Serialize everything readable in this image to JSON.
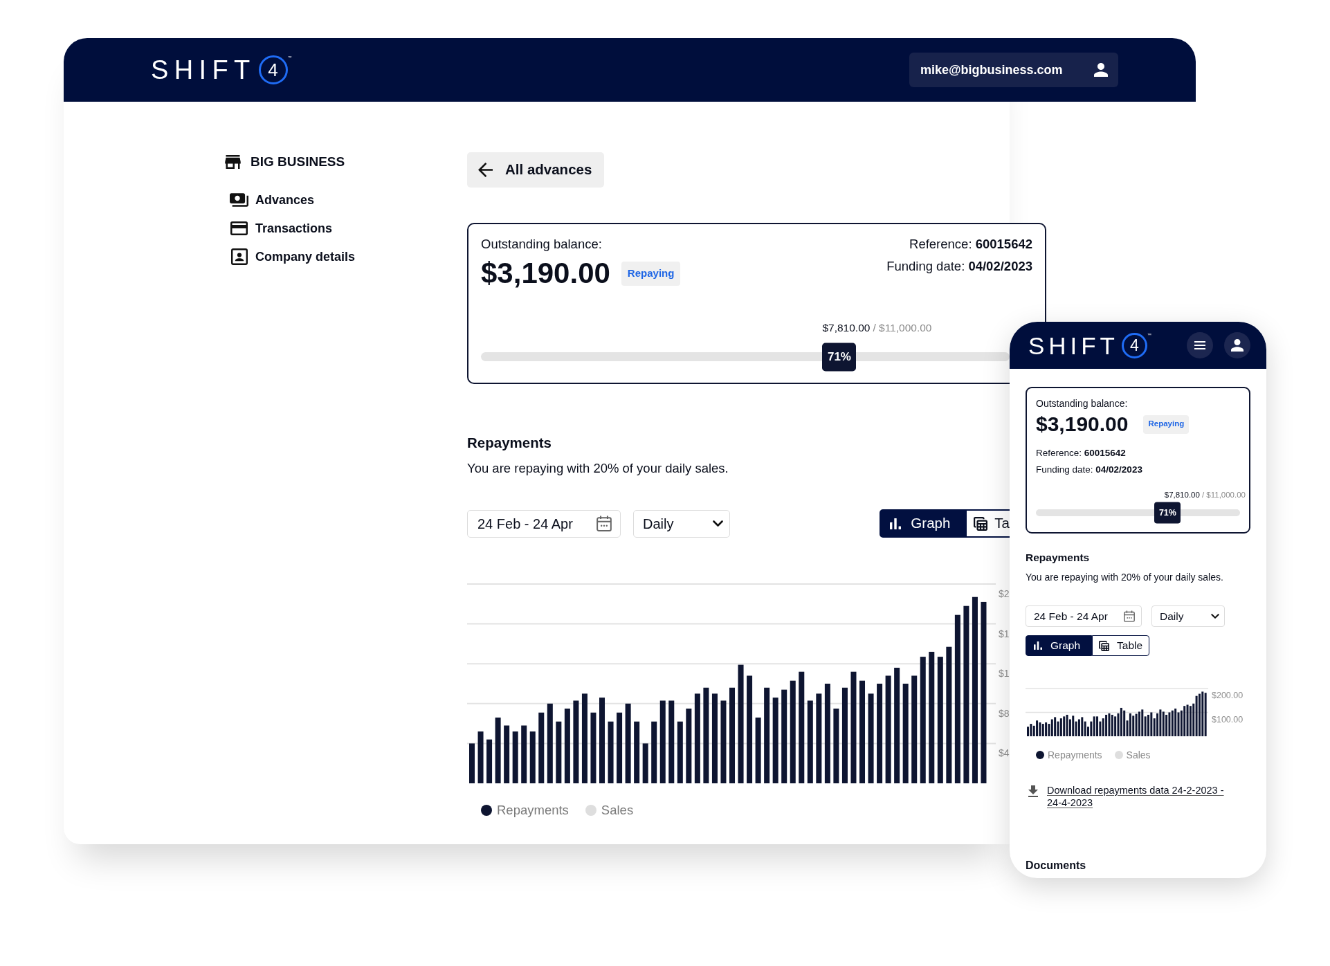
{
  "desktop": {
    "header": {
      "logo": {
        "word": "SHIFT",
        "digit": "4",
        "mark": "™"
      },
      "account_email": "mike@bigbusiness.com"
    },
    "sidebar": {
      "business_name": "BIG BUSINESS",
      "items": [
        {
          "label": "Advances"
        },
        {
          "label": "Transactions"
        },
        {
          "label": "Company details"
        }
      ]
    },
    "back_button": "All advances",
    "balance_card": {
      "label": "Outstanding balance:",
      "amount": "$3,190.00",
      "status": "Repaying",
      "reference": "Reference: **60015642**",
      "funding": "Funding date: **04/02/2023**",
      "paid": "$7,810.00",
      "total": "/ $11,000.00",
      "percent": "71%",
      "level": 0.71
    },
    "repayments": {
      "title": "Repayments",
      "description": "You are repaying with 20% of your daily sales.",
      "date_range": "24 Feb - 24 Apr",
      "interval": "Daily",
      "view_tabs": [
        {
          "label": "Graph",
          "selected": true
        },
        {
          "label": "Ta",
          "selected": false
        }
      ],
      "axis_labels": [
        "$2",
        "$1",
        "$1",
        "$8",
        "$4"
      ],
      "legend": [
        {
          "label": "Repayments",
          "color": "#0e1531"
        },
        {
          "label": "Sales",
          "color": "#dedede"
        }
      ]
    }
  },
  "mobile": {
    "header": {
      "logo": {
        "word": "SHIFT",
        "digit": "4",
        "mark": "™"
      }
    },
    "balance_card": {
      "label": "Outstanding balance:",
      "amount": "$3,190.00",
      "status": "Repaying",
      "reference": "Reference: **60015642**",
      "funding": "Funding date: **04/02/2023**",
      "paid": "$7,810.00",
      "total": "/ $11,000.00",
      "percent": "71%",
      "level": 0.71
    },
    "repayments": {
      "title": "Repayments",
      "description": "You are repaying with 20% of your daily sales.",
      "date_range": "24 Feb - 24 Apr",
      "interval": "Daily",
      "view_tabs": [
        {
          "label": "Graph",
          "selected": true
        },
        {
          "label": "Table",
          "selected": false
        }
      ],
      "chart_data": {
        "type": "bar",
        "categories": [
          null,
          null,
          null,
          null,
          null,
          null,
          null,
          null,
          null,
          null,
          null,
          null,
          null,
          null,
          null,
          null,
          null,
          null,
          null,
          null,
          null,
          null,
          null,
          null,
          null,
          null,
          null,
          null,
          null,
          null,
          null,
          null,
          null,
          null,
          null,
          null,
          null,
          null,
          null,
          null,
          null,
          null,
          null,
          null,
          null,
          null,
          null,
          null,
          null,
          null,
          null,
          null,
          null,
          null,
          null,
          null,
          null,
          null,
          null,
          null
        ],
        "values": [
          40,
          52,
          44,
          66,
          58,
          52,
          58,
          52,
          71,
          80,
          62,
          75,
          83,
          90,
          71,
          86,
          62,
          71,
          80,
          62,
          40,
          62,
          83,
          83,
          62,
          75,
          90,
          96,
          90,
          83,
          96,
          119,
          108,
          66,
          96,
          86,
          94,
          103,
          112,
          83,
          90,
          100,
          75,
          96,
          112,
          103,
          90,
          100,
          108,
          116,
          100,
          108,
          127,
          132,
          127,
          137,
          169,
          178,
          187,
          182
        ],
        "ylim": [
          0,
          200
        ],
        "yticks": [
          {
            "value": 100,
            "label": "$100.00"
          },
          {
            "value": 200,
            "label": "$200.00"
          }
        ]
      },
      "legend": [
        {
          "label": "Repayments",
          "color": "#0e1531"
        },
        {
          "label": "Sales",
          "color": "#dedede"
        }
      ],
      "download_link": "Download repayments data 24-2-2023 - 24-4-2023"
    },
    "documents": {
      "title": "Documents"
    }
  }
}
